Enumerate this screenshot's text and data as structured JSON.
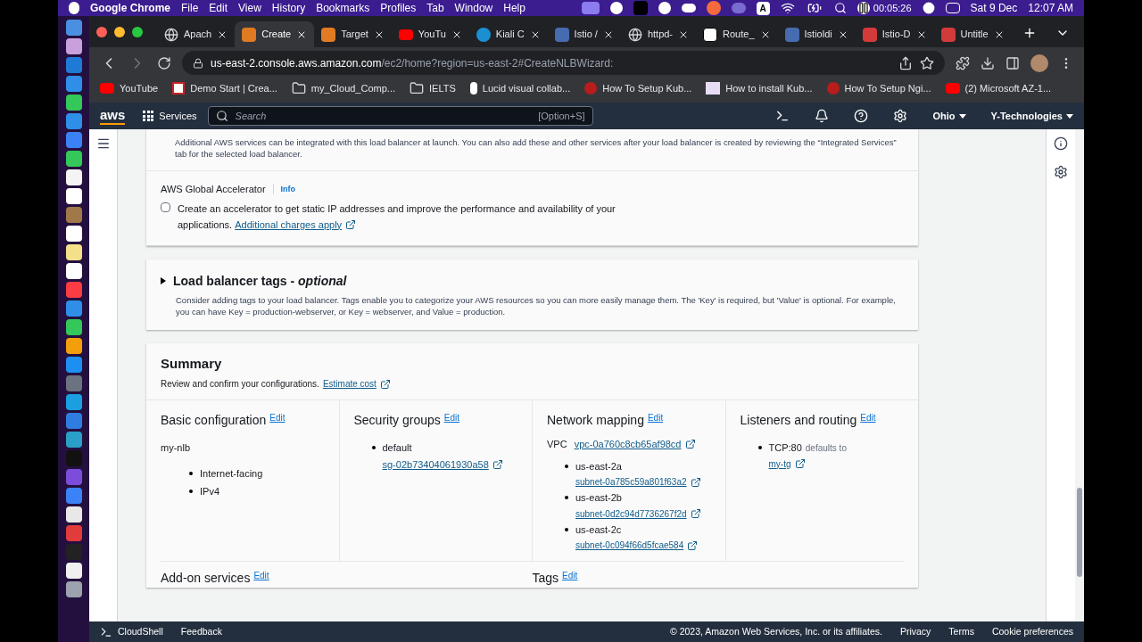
{
  "menubar": {
    "app": "Google Chrome",
    "menus": [
      "File",
      "Edit",
      "View",
      "History",
      "Bookmarks",
      "Profiles",
      "Tab",
      "Window",
      "Help"
    ],
    "input_source": "A",
    "recording_time": "00:05:26",
    "date": "Sat 9 Dec",
    "time": "12:07 AM"
  },
  "tabs": [
    {
      "label": "Apach",
      "selected": false
    },
    {
      "label": "Create",
      "selected": true
    },
    {
      "label": "Target",
      "selected": false
    },
    {
      "label": "YouTu",
      "selected": false
    },
    {
      "label": "Kiali C",
      "selected": false
    },
    {
      "label": "Istio / ",
      "selected": false
    },
    {
      "label": "httpd-",
      "selected": false
    },
    {
      "label": "Route_",
      "selected": false
    },
    {
      "label": "Istioldi",
      "selected": false
    },
    {
      "label": "Istio-D",
      "selected": false
    },
    {
      "label": "Untitle",
      "selected": false
    }
  ],
  "address": {
    "host": "us-east-2.console.aws.amazon.com",
    "path": "/ec2/home?region=us-east-2#CreateNLBWizard:"
  },
  "bookmarks": [
    "YouTube",
    "Demo Start | Crea...",
    "my_Cloud_Comp...",
    "IELTS",
    "Lucid visual collab...",
    "How To Setup Kub...",
    "How to install Kub...",
    "How To Setup Ngi...",
    "(2) Microsoft AZ-1..."
  ],
  "console": {
    "logo": "aws",
    "services": "Services",
    "search_placeholder": "Search",
    "shortcut": "[Option+S]",
    "region": "Ohio",
    "account": "Y-Technologies"
  },
  "addon_section": {
    "description": "Additional AWS services can be integrated with this load balancer at launch. You can also add these and other services after your load balancer is created by reviewing the “Integrated Services” tab for the selected load balancer.",
    "accelerator_title": "AWS Global Accelerator",
    "info": "Info",
    "checkbox": {
      "label": "Create an accelerator to get static IP addresses and improve the performance and availability of your applications.",
      "link": "Additional charges apply",
      "checked": false
    }
  },
  "tags_section": {
    "title": "Load balancer tags - ",
    "title_suffix": "optional",
    "expanded": false,
    "description": "Consider adding tags to your load balancer. Tags enable you to categorize your AWS resources so you can more easily manage them. The 'Key' is required, but 'Value' is optional. For example, you can have Key = production-webserver, or Key = webserver, and Value = production."
  },
  "summary": {
    "title": "Summary",
    "subtitle": "Review and confirm your configurations.",
    "cost_link": "Estimate cost",
    "columns": [
      {
        "kind": "basic",
        "title": "Basic configuration",
        "edit": "Edit",
        "name": "my-nlb",
        "items": [
          "Internet-facing",
          "IPv4"
        ]
      },
      {
        "kind": "security",
        "title": "Security groups",
        "edit": "Edit",
        "items": [
          {
            "label": "default",
            "link": "sg-02b73404061930a58"
          }
        ]
      },
      {
        "kind": "network",
        "title": "Network mapping",
        "edit": "Edit",
        "vpc_label": "VPC",
        "vpc": "vpc-0a760c8cb65af98cd",
        "items": [
          {
            "label": "us-east-2a",
            "link": "subnet-0a785c59a801f63a2"
          },
          {
            "label": "us-east-2b",
            "link": "subnet-0d2c94d7736267f2d"
          },
          {
            "label": "us-east-2c",
            "link": "subnet-0c094f66d5fcae584"
          }
        ]
      },
      {
        "kind": "listeners",
        "title": "Listeners and routing",
        "edit": "Edit",
        "items": [
          {
            "label": "TCP:80",
            "note": "defaults to",
            "link": "my-tg"
          }
        ]
      }
    ],
    "bottom": [
      {
        "title": "Add-on services",
        "edit": "Edit"
      },
      {
        "title": "Tags",
        "edit": "Edit"
      }
    ]
  },
  "footer": {
    "cloudshell": "CloudShell",
    "feedback": "Feedback",
    "copyright": "© 2023, Amazon Web Services, Inc. or its affiliates.",
    "links": [
      "Privacy",
      "Terms",
      "Cookie preferences"
    ]
  }
}
